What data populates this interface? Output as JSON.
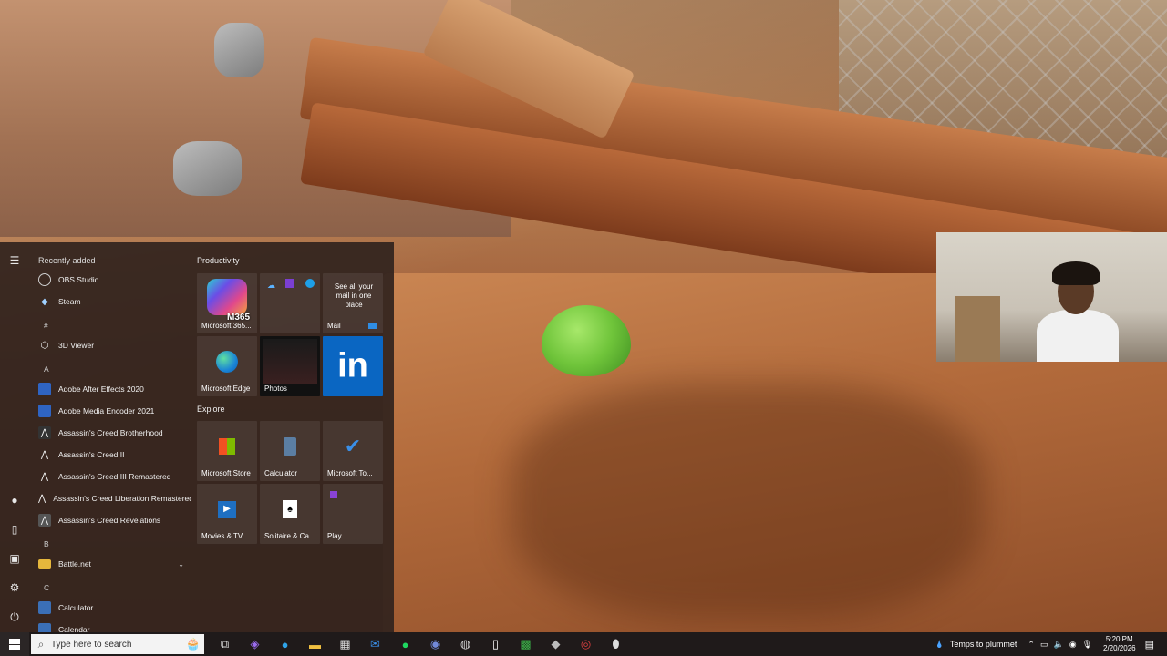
{
  "start_menu": {
    "recently_added_header": "Recently added",
    "recent": [
      {
        "label": "OBS Studio",
        "icon": "obs-icon"
      },
      {
        "label": "Steam",
        "icon": "steam-icon"
      }
    ],
    "sections": [
      {
        "letter": "#",
        "apps": [
          {
            "label": "3D Viewer",
            "icon": "cube-icon"
          }
        ]
      },
      {
        "letter": "A",
        "apps": [
          {
            "label": "Adobe After Effects 2020",
            "icon": "ae-icon"
          },
          {
            "label": "Adobe Media Encoder 2021",
            "icon": "me-icon"
          },
          {
            "label": "Assassin's Creed Brotherhood",
            "icon": "ac-icon"
          },
          {
            "label": "Assassin's Creed II",
            "icon": "ac-icon"
          },
          {
            "label": "Assassin's Creed III Remastered",
            "icon": "ac-icon"
          },
          {
            "label": "Assassin's Creed Liberation Remastered",
            "icon": "ac-icon"
          },
          {
            "label": "Assassin's Creed Revelations",
            "icon": "ac-icon"
          }
        ]
      },
      {
        "letter": "B",
        "apps": [
          {
            "label": "Battle.net",
            "icon": "folder-icon"
          }
        ]
      },
      {
        "letter": "C",
        "apps": [
          {
            "label": "Calculator",
            "icon": "calculator-icon"
          },
          {
            "label": "Calendar",
            "icon": "calendar-icon"
          }
        ]
      }
    ],
    "groups": {
      "productivity": "Productivity",
      "explore": "Explore"
    },
    "tiles": {
      "m365_badge": "M365",
      "m365": "Microsoft 365...",
      "mail_text": "See all your mail in one place",
      "mail": "Mail",
      "edge": "Microsoft Edge",
      "photos": "Photos",
      "store": "Microsoft Store",
      "calculator": "Calculator",
      "todo": "Microsoft To...",
      "movies": "Movies & TV",
      "solitaire": "Solitaire & Ca...",
      "play": "Play"
    }
  },
  "taskbar": {
    "search_placeholder": "Type here to search",
    "notification_text": "Temps to plummet",
    "time": "5:20 PM",
    "date": "2/20/2026"
  }
}
